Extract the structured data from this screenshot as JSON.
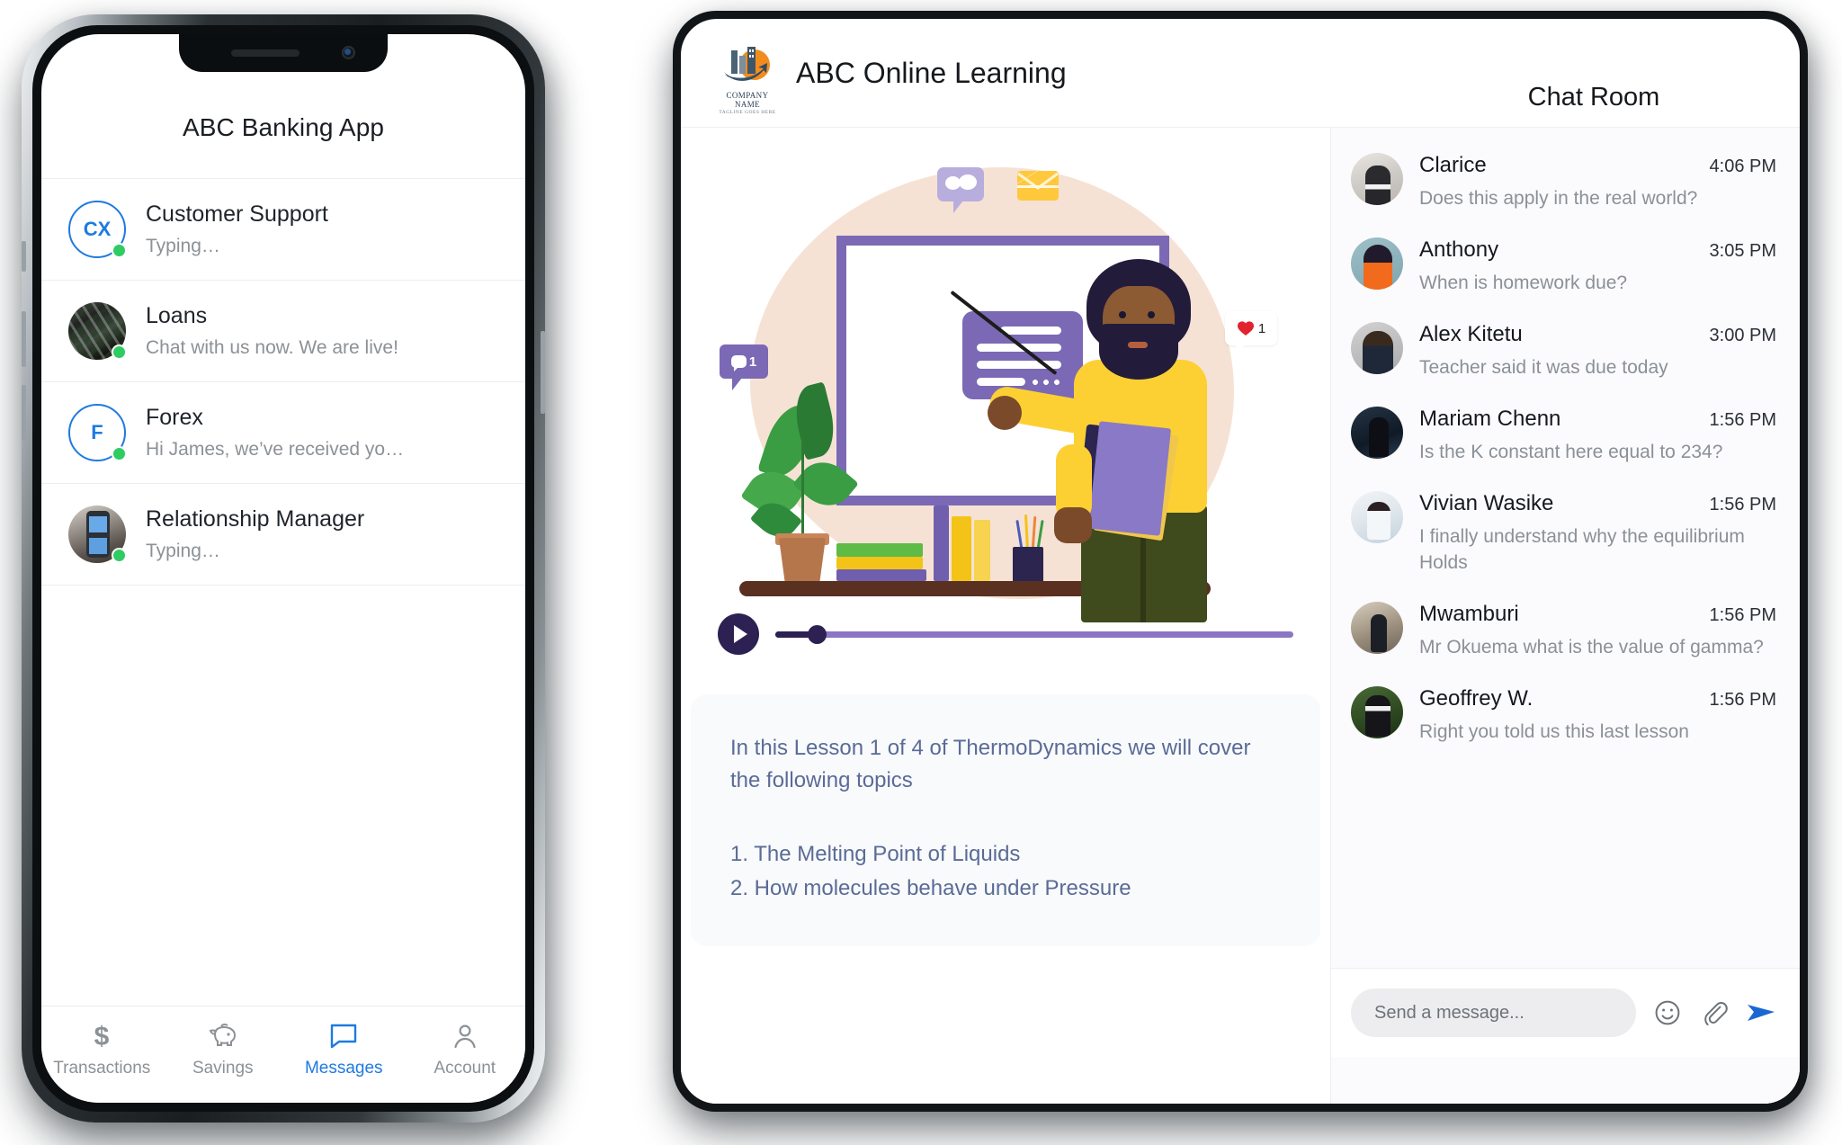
{
  "phone": {
    "title": "ABC Banking App",
    "conversations": [
      {
        "name": "Customer Support",
        "snippet": "Typing…",
        "avatar_type": "initials",
        "initials": "CX",
        "online": true
      },
      {
        "name": "Loans",
        "snippet": "Chat with us now. We are live!",
        "avatar_type": "photo-loans",
        "initials": "",
        "online": true
      },
      {
        "name": "Forex",
        "snippet": "Hi James, we’ve received yo…",
        "avatar_type": "initials",
        "initials": "F",
        "online": true
      },
      {
        "name": "Relationship Manager",
        "snippet": "Typing…",
        "avatar_type": "photo-rm",
        "initials": "",
        "online": true
      }
    ],
    "tabs": [
      {
        "label": "Transactions",
        "icon": "dollar-icon",
        "active": false
      },
      {
        "label": "Savings",
        "icon": "piggy-bank-icon",
        "active": false
      },
      {
        "label": "Messages",
        "icon": "chat-bubble-icon",
        "active": true
      },
      {
        "label": "Account",
        "icon": "person-icon",
        "active": false
      }
    ],
    "accent_color": "#1f7ae0",
    "online_color": "#2ecc62"
  },
  "tablet": {
    "logo": {
      "company": "COMPANY NAME",
      "tagline": "TAGLINE GOES HERE"
    },
    "app_title": "ABC Online Learning",
    "chat_title": "Chat Room",
    "illustration": {
      "badge_chat_top": "chat-bubbles-badge",
      "badge_mail": "envelope-icon",
      "badge_comment_count": "1",
      "badge_heart_count": "1"
    },
    "player": {
      "play_icon": "play-icon",
      "progress_percent": 5
    },
    "lesson": {
      "intro": "In this Lesson 1 of 4 of ThermoDynamics we will cover the following topics",
      "topics": [
        "1. The Melting Point of Liquids",
        "2. How molecules behave under Pressure"
      ]
    },
    "messages": [
      {
        "name": "Clarice",
        "time": "4:06 PM",
        "text": "Does this apply in the real world?",
        "avatar": "av-clarice"
      },
      {
        "name": "Anthony",
        "time": "3:05 PM",
        "text": "When is homework due?",
        "avatar": "av-anthony"
      },
      {
        "name": "Alex Kitetu",
        "time": "3:00 PM",
        "text": "Teacher said it was due today",
        "avatar": "av-alex"
      },
      {
        "name": "Mariam Chenn",
        "time": "1:56 PM",
        "text": "Is the K constant here equal to 234?",
        "avatar": "av-mariam"
      },
      {
        "name": "Vivian Wasike",
        "time": "1:56 PM",
        "text": "I finally understand why the equilibrium Holds",
        "avatar": "av-vivian"
      },
      {
        "name": "Mwamburi",
        "time": "1:56 PM",
        "text": "Mr Okuema what is the value of gamma?",
        "avatar": "av-mwamburi"
      },
      {
        "name": "Geoffrey W.",
        "time": "1:56 PM",
        "text": "Right you told us this last lesson",
        "avatar": "av-geoffrey"
      }
    ],
    "composer": {
      "placeholder": "Send a message...",
      "emoji_icon": "smiley-icon",
      "attach_icon": "paperclip-icon",
      "send_icon": "send-icon",
      "send_color": "#1967d2"
    },
    "purple": "#7b69b5",
    "deep_purple": "#2c2152",
    "blob_color": "#f6e2d4"
  }
}
